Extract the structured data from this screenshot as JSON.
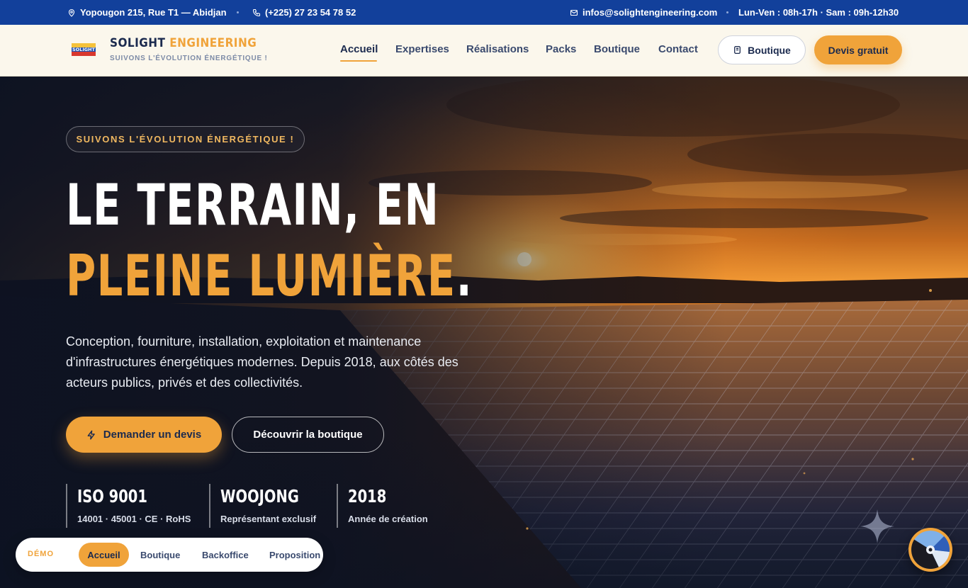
{
  "topbar": {
    "address": "Yopougon 215, Rue T1 — Abidjan",
    "phone": "(+225) 27 23 54 78 52",
    "email": "infos@solightengineering.com",
    "hours": "Lun-Ven : 08h-17h · Sam : 09h-12h30"
  },
  "header": {
    "logo_text": "SOLIGHT",
    "brand_name_1": "SOLIGHT",
    "brand_name_2": "ENGINEERING",
    "tagline": "SUIVONS L'ÉVOLUTION ÉNERGÉTIQUE !",
    "nav": [
      {
        "label": "Accueil",
        "active": true
      },
      {
        "label": "Expertises"
      },
      {
        "label": "Réalisations"
      },
      {
        "label": "Packs"
      },
      {
        "label": "Boutique"
      },
      {
        "label": "Contact"
      }
    ],
    "shop_button": "Boutique",
    "quote_button": "Devis gratuit"
  },
  "hero": {
    "pill": "SUIVONS L'ÉVOLUTION ÉNERGÉTIQUE !",
    "title_line_1": "LE TERRAIN, EN",
    "title_line_2": "PLEINE LUMIÈRE",
    "title_period": ".",
    "description": "Conception, fourniture, installation, exploitation et maintenance d'infrastructures énergétiques modernes. Depuis 2018, aux côtés des acteurs publics, privés et des collectivités.",
    "cta_primary": "Demander un devis",
    "cta_secondary": "Découvrir la boutique",
    "stats": [
      {
        "value": "ISO 9001",
        "label": "14001 · 45001 · CE · RoHS"
      },
      {
        "value": "WOOJONG",
        "label": "Représentant exclusif"
      },
      {
        "value": "2018",
        "label": "Année de création"
      }
    ]
  },
  "demo_bar": {
    "label": "DÉMO",
    "items": [
      {
        "label": "Accueil",
        "active": true
      },
      {
        "label": "Boutique"
      },
      {
        "label": "Backoffice"
      },
      {
        "label": "Proposition"
      }
    ]
  },
  "colors": {
    "topbar": "#12409b",
    "header_bg": "#fbf7ec",
    "accent": "#f0a33a",
    "navy": "#1b2a4e"
  },
  "icons": {
    "address": "map-pin-icon",
    "phone": "phone-icon",
    "email": "mail-icon",
    "shop": "store-icon",
    "cta": "lightning-icon"
  }
}
